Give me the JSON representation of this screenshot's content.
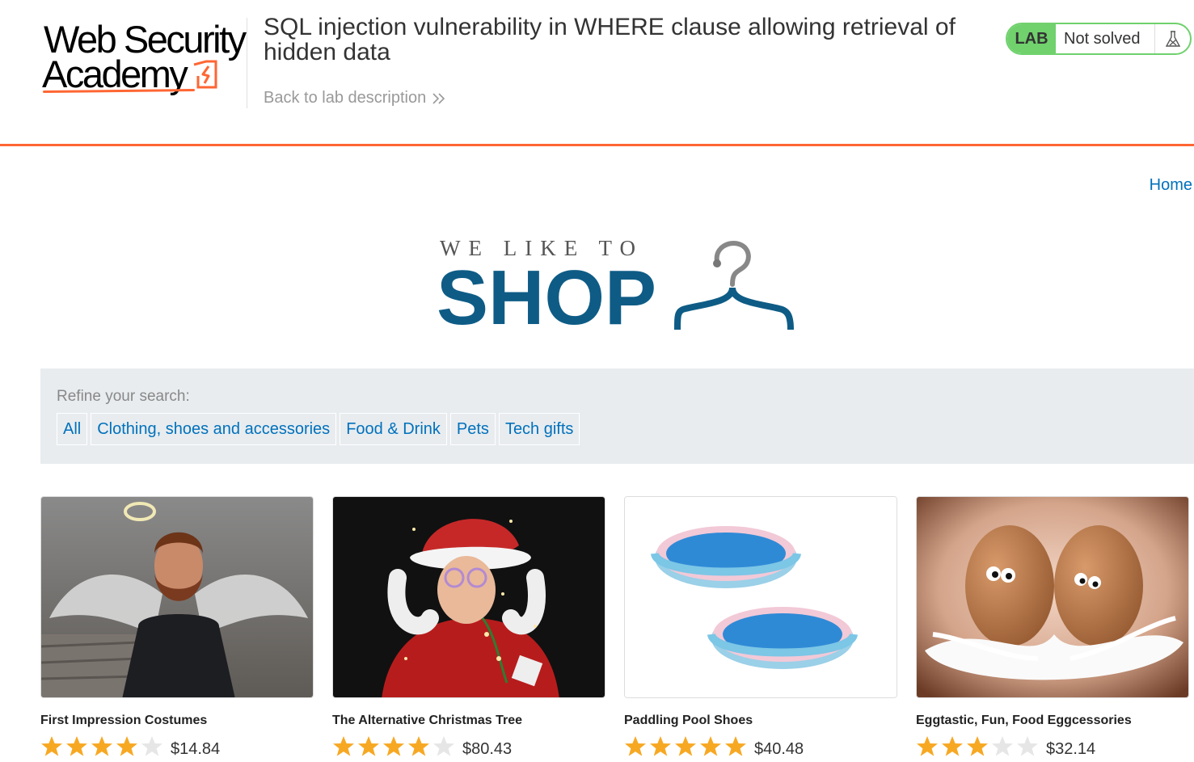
{
  "header": {
    "logo": {
      "line1": "Web Security",
      "line2": "Academy"
    },
    "lab_title": "SQL injection vulnerability in WHERE clause allowing retrieval of hidden data",
    "back_link": "Back to lab description",
    "lab_badge": "LAB",
    "lab_status": "Not solved",
    "flask_icon": "flask-icon",
    "chevron_icon": "double-chevron-right-icon"
  },
  "nav": {
    "home": "Home"
  },
  "hero": {
    "tagline": "WE LIKE TO",
    "title": "SHOP",
    "hanger_icon": "coat-hanger-icon"
  },
  "filter": {
    "label": "Refine your search:",
    "categories": [
      "All",
      "Clothing, shoes and accessories",
      "Food & Drink",
      "Pets",
      "Tech gifts"
    ]
  },
  "products": [
    {
      "name": "First Impression Costumes",
      "price": "$14.84",
      "rating": 4,
      "max_rating": 5,
      "image": "man-with-angel-wings-and-halo"
    },
    {
      "name": "The Alternative Christmas Tree",
      "price": "$80.43",
      "rating": 4,
      "max_rating": 5,
      "image": "man-in-santa-hat-wrapped-in-lights"
    },
    {
      "name": "Paddling Pool Shoes",
      "price": "$40.48",
      "rating": 5,
      "max_rating": 5,
      "image": "two-inflatable-paddling-pools"
    },
    {
      "name": "Eggtastic, Fun, Food Eggcessories",
      "price": "$32.14",
      "rating": 3,
      "max_rating": 5,
      "image": "two-eggs-with-googly-eyes-on-feathers"
    }
  ],
  "colors": {
    "accent_orange": "#ff6633",
    "link_blue": "#0071bc",
    "hero_blue": "#0e5c86",
    "lab_green": "#70d16d",
    "star_gold": "#f7a823",
    "star_empty": "#e6e6e6"
  }
}
